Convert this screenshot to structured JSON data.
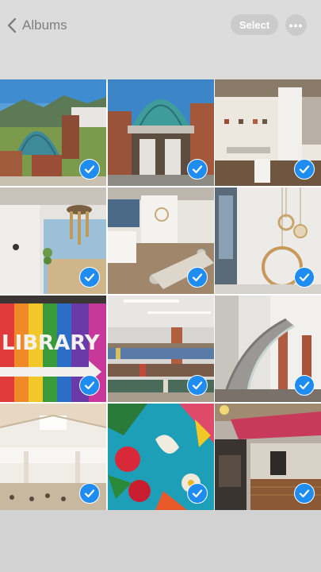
{
  "header": {
    "back_label": "Albums",
    "select_label": "Select",
    "more_icon": "ellipsis-icon"
  },
  "colors": {
    "selection_check": "#1e8cf0",
    "header_bg": "#dcdcdc"
  },
  "photos": [
    {
      "name": "glass-dome-exterior-mountains",
      "selected": true
    },
    {
      "name": "glass-dome-entrance",
      "selected": true
    },
    {
      "name": "gallery-room-white-walls",
      "selected": true
    },
    {
      "name": "wind-chime-window",
      "selected": true
    },
    {
      "name": "art-installation-rolls",
      "selected": true
    },
    {
      "name": "hanging-rings-art",
      "selected": true
    },
    {
      "name": "rainbow-library-banner",
      "selected": true
    },
    {
      "name": "library-bookshelves",
      "selected": true
    },
    {
      "name": "spiral-staircase",
      "selected": true
    },
    {
      "name": "atrium-seating",
      "selected": true
    },
    {
      "name": "floral-mural",
      "selected": true
    },
    {
      "name": "cafe-counter",
      "selected": true
    }
  ],
  "banner_text": "LIBRARY"
}
